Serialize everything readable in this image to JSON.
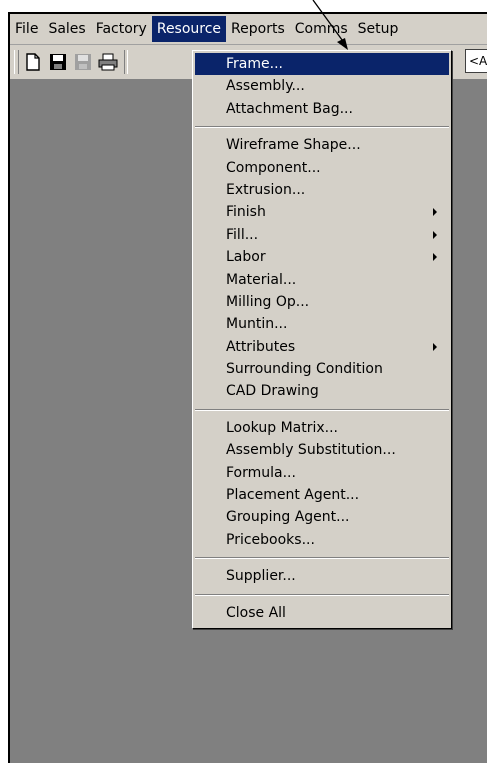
{
  "menubar": {
    "items": [
      "File",
      "Sales",
      "Factory",
      "Resource",
      "Reports",
      "Comms",
      "Setup"
    ],
    "active_index": 3
  },
  "toolbar": {
    "icons": [
      "new-document-icon",
      "save-icon",
      "save-all-icon",
      "print-icon"
    ],
    "combo_value": "<A"
  },
  "resource_menu": {
    "sections": [
      [
        {
          "label": "Frame...",
          "highlighted": true
        },
        {
          "label": "Assembly..."
        },
        {
          "label": "Attachment Bag..."
        }
      ],
      [
        {
          "label": "Wireframe Shape..."
        },
        {
          "label": "Component..."
        },
        {
          "label": "Extrusion..."
        },
        {
          "label": "Finish",
          "submenu": true
        },
        {
          "label": "Fill...",
          "submenu": true
        },
        {
          "label": "Labor",
          "submenu": true
        },
        {
          "label": "Material..."
        },
        {
          "label": "Milling Op..."
        },
        {
          "label": "Muntin..."
        },
        {
          "label": "Attributes",
          "submenu": true
        },
        {
          "label": "Surrounding Condition"
        },
        {
          "label": "CAD Drawing"
        }
      ],
      [
        {
          "label": "Lookup Matrix..."
        },
        {
          "label": "Assembly Substitution..."
        },
        {
          "label": "Formula..."
        },
        {
          "label": "Placement Agent..."
        },
        {
          "label": "Grouping Agent..."
        },
        {
          "label": "Pricebooks..."
        }
      ],
      [
        {
          "label": "Supplier..."
        }
      ],
      [
        {
          "label": "Close All"
        }
      ]
    ]
  },
  "colors": {
    "highlight": "#0a246a",
    "face": "#d4d0c8",
    "workspace": "#808080"
  }
}
